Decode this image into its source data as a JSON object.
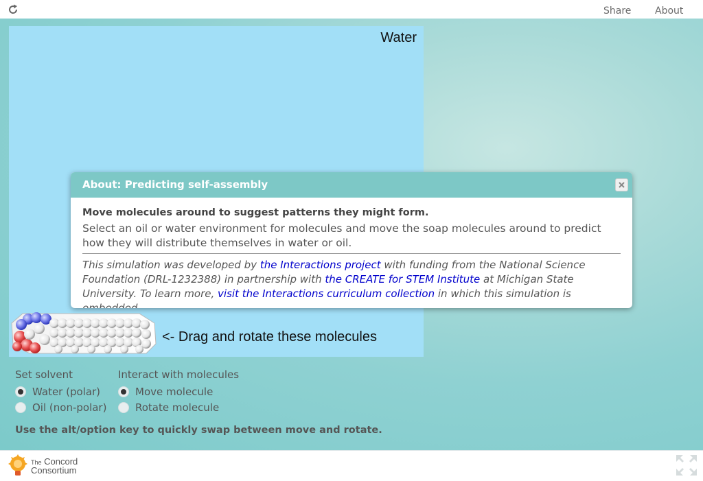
{
  "topbar": {
    "reload_icon": "reload-icon",
    "share_label": "Share",
    "about_label": "About"
  },
  "simulation": {
    "title": "Water",
    "drag_hint": "<- Drag and rotate these molecules",
    "background_color": "#a2dff7"
  },
  "controls": {
    "solvent": {
      "heading": "Set solvent",
      "options": [
        {
          "label": "Water (polar)",
          "checked": true
        },
        {
          "label": "Oil (non-polar)",
          "checked": false
        }
      ]
    },
    "interaction": {
      "heading": "Interact with molecules",
      "options": [
        {
          "label": "Move molecule",
          "checked": true
        },
        {
          "label": "Rotate molecule",
          "checked": false
        }
      ]
    },
    "hint": "Use the alt/option key to quickly swap between move and rotate."
  },
  "dialog": {
    "title": "About: Predicting self-assembly",
    "close_icon": "close-icon",
    "lead": "Move molecules around to suggest patterns they might form.",
    "description": "Select an oil or water environment for molecules and move the soap molecules around to predict how they will distribute themselves in water or oil.",
    "credit": {
      "part1": "This simulation was developed by ",
      "link1": "the Interactions project",
      "part2": " with funding from the National Science Foundation (DRL-1232388) in partnership with ",
      "link2": "the CREATE for STEM Institute",
      "part3": " at Michigan State University. To learn more, ",
      "link3": "visit the Interactions curriculum collection",
      "part4": " in which this simulation is embedded."
    }
  },
  "footer": {
    "logo_line1_small": "The",
    "logo_line1": "Concord",
    "logo_line2": "Consortium",
    "fullscreen_icon": "fullscreen-icon"
  },
  "colors": {
    "accent": "#7dc8c6",
    "link": "#0000cc"
  }
}
